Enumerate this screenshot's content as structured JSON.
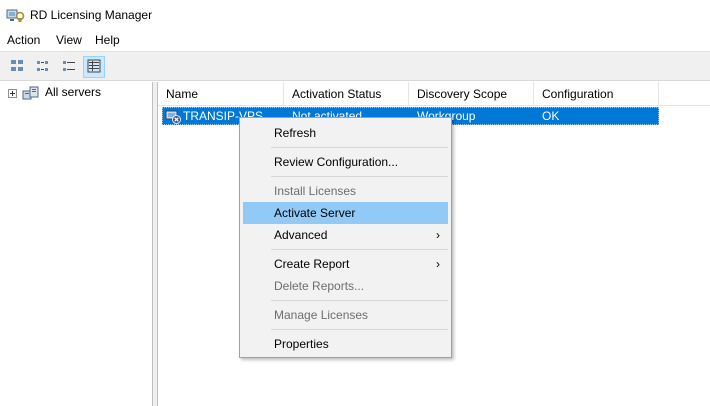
{
  "window": {
    "title": "RD Licensing Manager",
    "icon": "rd-licensing-icon"
  },
  "menubar": {
    "items": [
      "Action",
      "View",
      "Help"
    ]
  },
  "toolbar": {
    "buttons": [
      {
        "icon": "large-icons-view-icon"
      },
      {
        "icon": "small-icons-view-icon"
      },
      {
        "icon": "list-view-icon"
      },
      {
        "icon": "details-view-icon",
        "active": true
      }
    ]
  },
  "tree": {
    "root_label": "All servers",
    "root_icon": "server-group-icon"
  },
  "list": {
    "columns": [
      "Name",
      "Activation Status",
      "Discovery Scope",
      "Configuration"
    ],
    "rows": [
      {
        "icon": "server-error-icon",
        "name": "TRANSIP-VPS",
        "activation_status": "Not activated",
        "discovery_scope": "Workgroup",
        "configuration": "OK",
        "selected": true
      }
    ]
  },
  "context_menu": {
    "items": [
      {
        "label": "Refresh",
        "enabled": true
      },
      {
        "label": "Review Configuration...",
        "enabled": true
      },
      {
        "label": "Install Licenses",
        "enabled": false
      },
      {
        "label": "Activate Server",
        "enabled": true,
        "highlighted": true
      },
      {
        "label": "Advanced",
        "enabled": true,
        "submenu": true
      },
      {
        "label": "Create Report",
        "enabled": true,
        "submenu": true
      },
      {
        "label": "Delete Reports...",
        "enabled": false
      },
      {
        "label": "Manage Licenses",
        "enabled": false
      },
      {
        "label": "Properties",
        "enabled": true
      }
    ],
    "submenu_arrow": "›"
  },
  "colors": {
    "selection": "#0078d7",
    "menu_highlight": "#91c9f7",
    "disabled_text": "#6d6d6d"
  }
}
